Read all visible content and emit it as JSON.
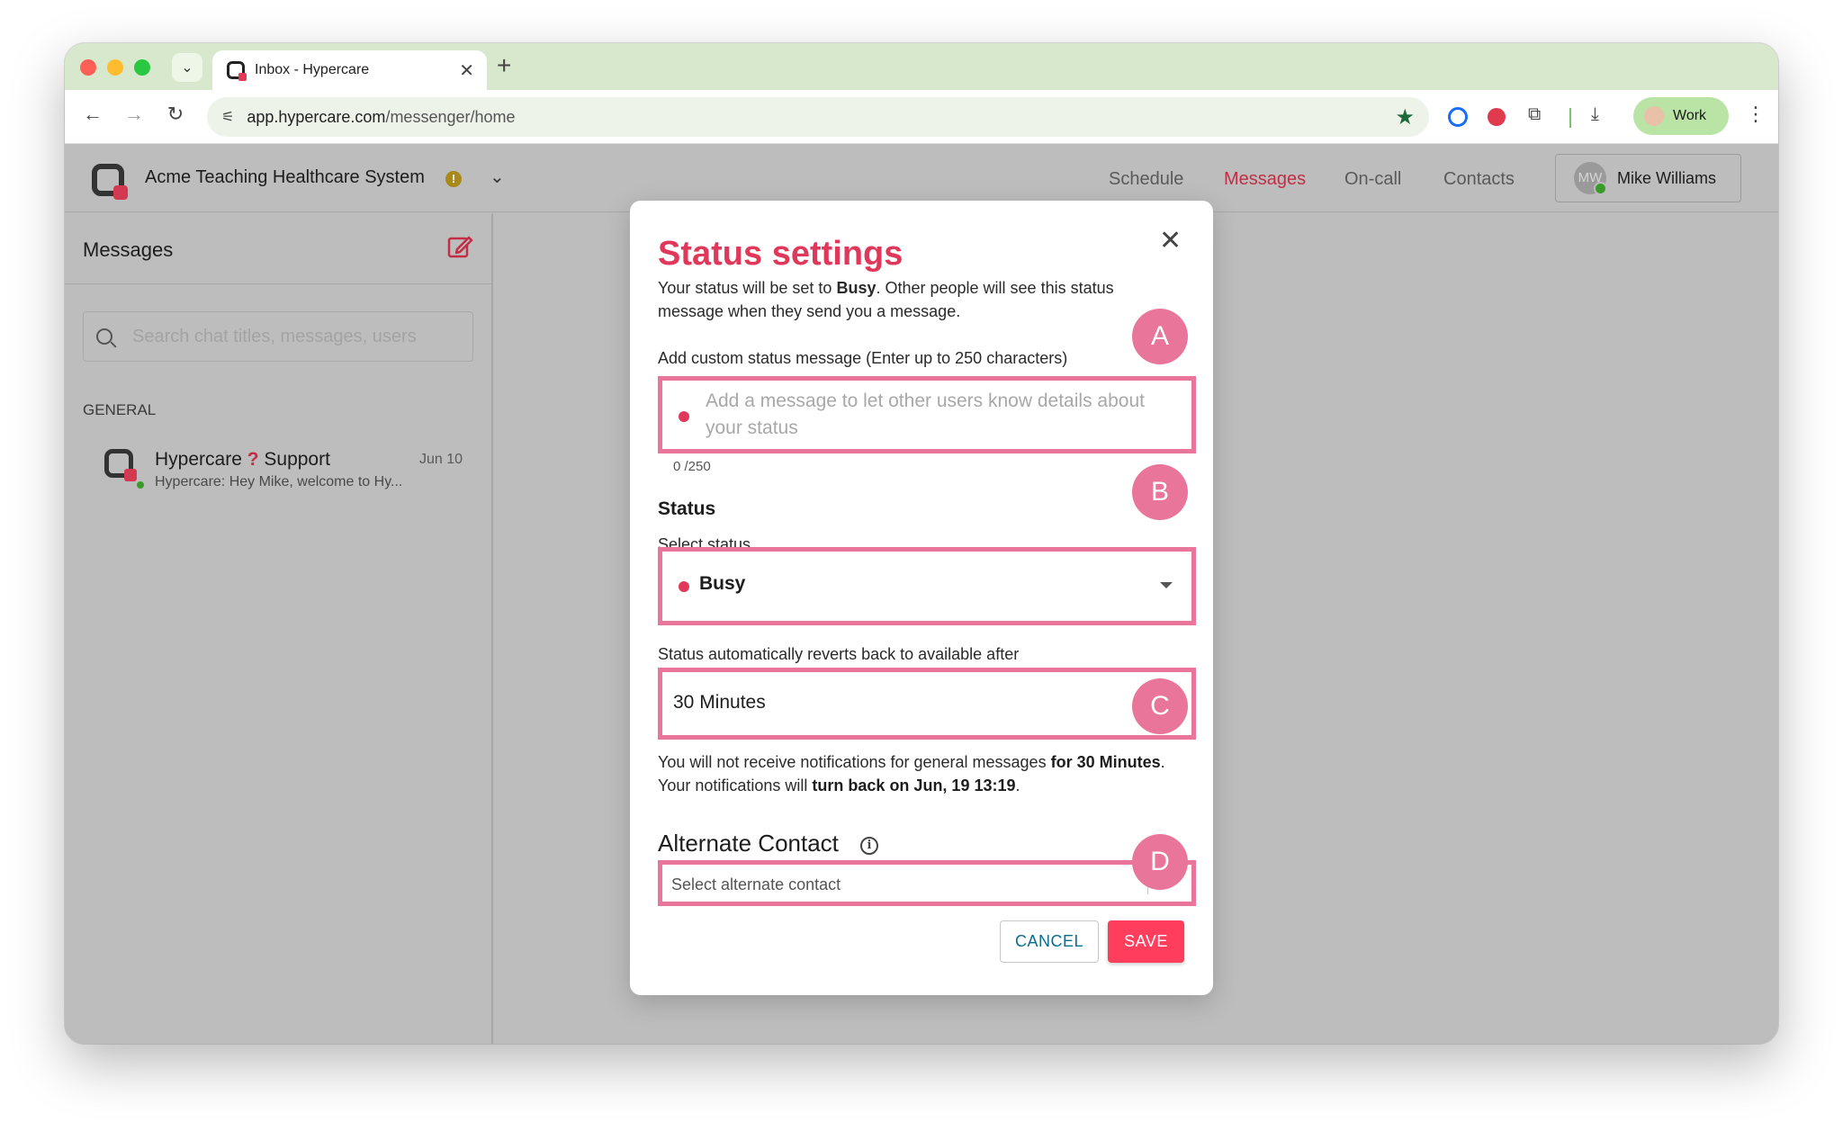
{
  "browser": {
    "tab_title": "Inbox - Hypercare",
    "tab_close": "✕",
    "new_tab": "+",
    "url_domain": "app.hypercare.com",
    "url_path": "/messenger/home",
    "profile_label": "Work"
  },
  "header": {
    "org_name": "Acme Teaching Healthcare System",
    "warning_glyph": "!",
    "nav": {
      "schedule": "Schedule",
      "messages": "Messages",
      "oncall": "On-call",
      "contacts": "Contacts"
    },
    "user_initials": "MW",
    "user_name": "Mike Williams"
  },
  "sidebar": {
    "title": "Messages",
    "search_placeholder": "Search chat titles, messages, users",
    "section": "GENERAL",
    "chats": [
      {
        "title_a": "Hypercare",
        "title_q": "?",
        "title_b": "Support",
        "date": "Jun 10",
        "preview": "Hypercare: Hey Mike, welcome to Hy..."
      }
    ]
  },
  "modal": {
    "title": "Status settings",
    "close_glyph": "✕",
    "desc_1": "Your status will be set to ",
    "desc_status": "Busy",
    "desc_2": ". Other people will see this status message when they send you a message.",
    "custom_label": "Add custom status message (Enter up to 250 characters)",
    "custom_placeholder": "Add a message to let other users know details about your status",
    "counter": "0 /250",
    "status_heading": "Status",
    "select_label": "Select status",
    "status_value": "Busy",
    "revert_label": "Status automatically reverts back to available after",
    "revert_value": "30 Minutes",
    "note_1": "You will not receive notifications for general messages ",
    "note_2": "for 30 Minutes",
    "note_3": ". Your notifications will ",
    "note_4": "turn back on Jun, 19 13:19",
    "note_5": ".",
    "alt_heading": "Alternate Contact",
    "info_glyph": "i",
    "alt_placeholder": "Select alternate contact",
    "cancel": "CANCEL",
    "save": "SAVE"
  },
  "annotations": {
    "a": "A",
    "b": "B",
    "c": "C",
    "d": "D"
  },
  "colors": {
    "accent": "#e0385b",
    "save_button": "#ff3e5e",
    "annotation": "#e9769a",
    "nav_active": "#c12e45",
    "tab_strip": "#d7e8cd"
  },
  "icons": {
    "tab_menu": "chevron-down-icon",
    "back": "arrow-left-icon",
    "forward": "arrow-right-icon",
    "reload": "reload-icon",
    "site_settings": "tune-icon",
    "bookmark": "star-icon",
    "compose": "compose-icon",
    "search": "search-icon",
    "close": "close-icon",
    "info": "info-icon"
  }
}
